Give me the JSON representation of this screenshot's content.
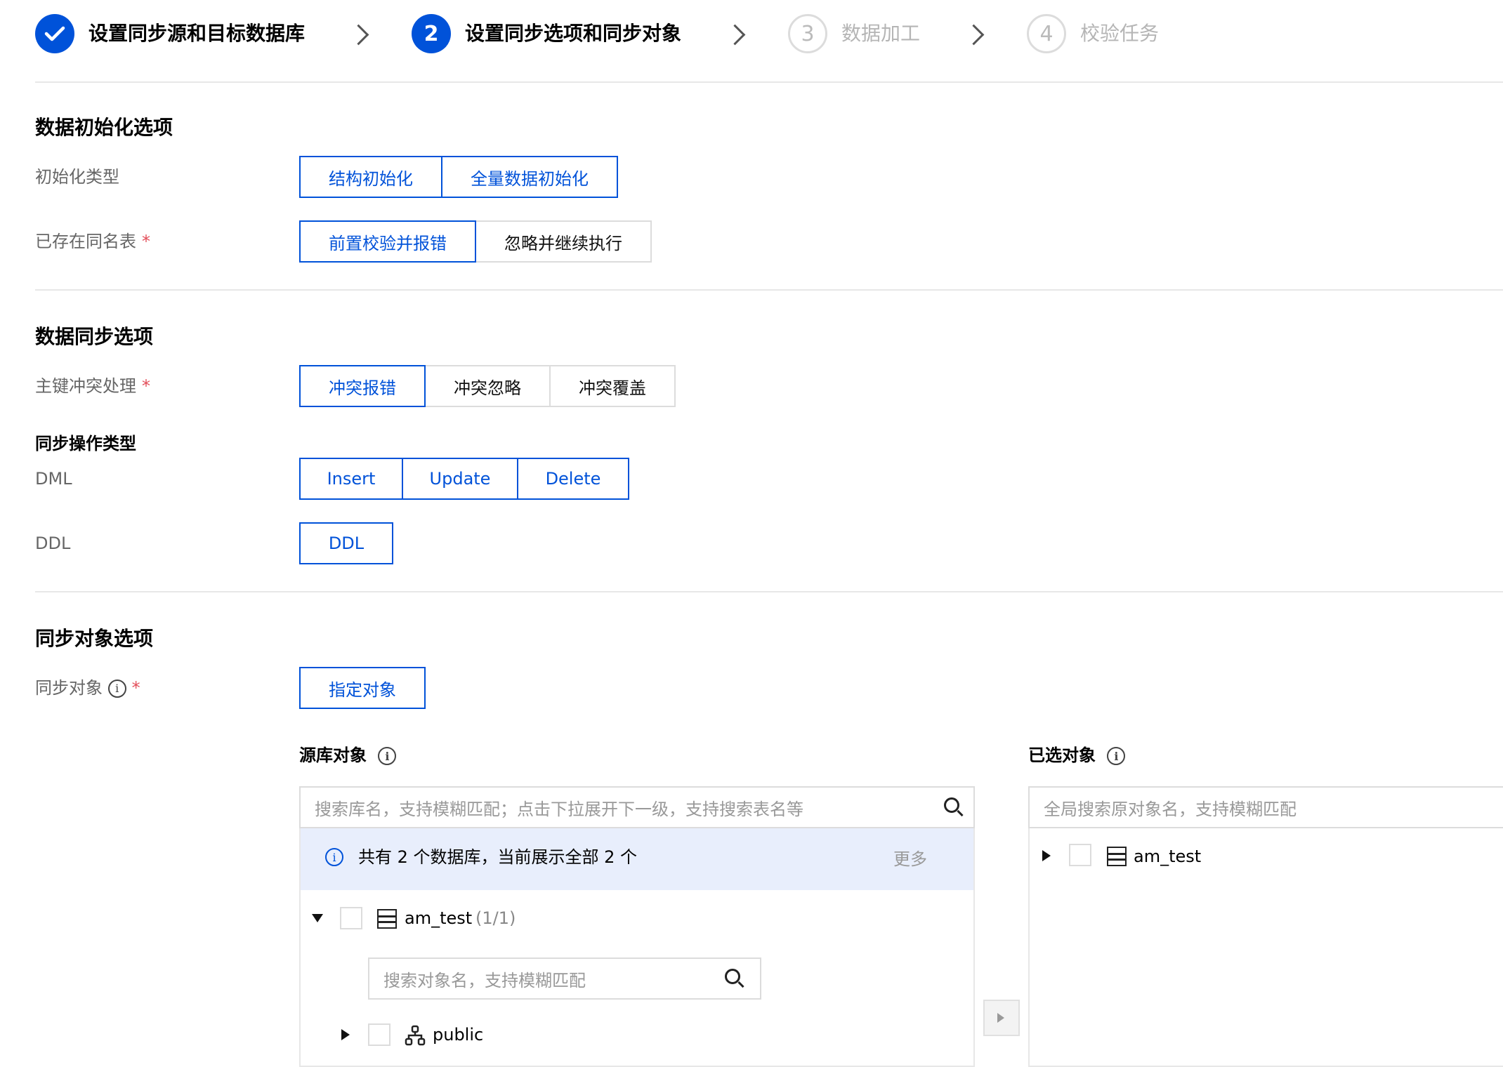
{
  "steps": [
    {
      "num": "",
      "label": "设置同步源和目标数据库",
      "state": "done"
    },
    {
      "num": "2",
      "label": "设置同步选项和同步对象",
      "state": "active"
    },
    {
      "num": "3",
      "label": "数据加工",
      "state": "todo"
    },
    {
      "num": "4",
      "label": "校验任务",
      "state": "todo"
    }
  ],
  "init_section": {
    "title": "数据初始化选项",
    "init_type_label": "初始化类型",
    "init_type_options": [
      "结构初始化",
      "全量数据初始化"
    ],
    "existing_table_label": "已存在同名表",
    "existing_table_options": [
      "前置校验并报错",
      "忽略并继续执行"
    ],
    "existing_table_selected": "前置校验并报错"
  },
  "sync_section": {
    "title": "数据同步选项",
    "pk_conflict_label": "主键冲突处理",
    "pk_conflict_options": [
      "冲突报错",
      "冲突忽略",
      "冲突覆盖"
    ],
    "pk_conflict_selected": "冲突报错",
    "op_type_label": "同步操作类型",
    "dml_label": "DML",
    "dml_options": [
      "Insert",
      "Update",
      "Delete"
    ],
    "ddl_label": "DDL",
    "ddl_options": [
      "DDL"
    ]
  },
  "object_section": {
    "title": "同步对象选项",
    "sync_object_label": "同步对象",
    "sync_object_options": [
      "指定对象"
    ],
    "source_title": "源库对象",
    "source_search_placeholder": "搜索库名，支持模糊匹配；点击下拉展开下一级，支持搜索表名等",
    "info_text": "共有 2 个数据库，当前展示全部 2 个",
    "more_label": "更多",
    "db_name": "am_test",
    "db_count": "(1/1)",
    "object_search_placeholder": "搜索对象名，支持模糊匹配",
    "schema_name": "public",
    "selected_title": "已选对象",
    "selected_search_placeholder": "全局搜索原对象名，支持模糊匹配",
    "selected_db_name": "am_test"
  },
  "required_mark": "*",
  "colors": {
    "primary": "#0052d9",
    "required": "#e34d59",
    "info_bg": "#e8eefc"
  }
}
